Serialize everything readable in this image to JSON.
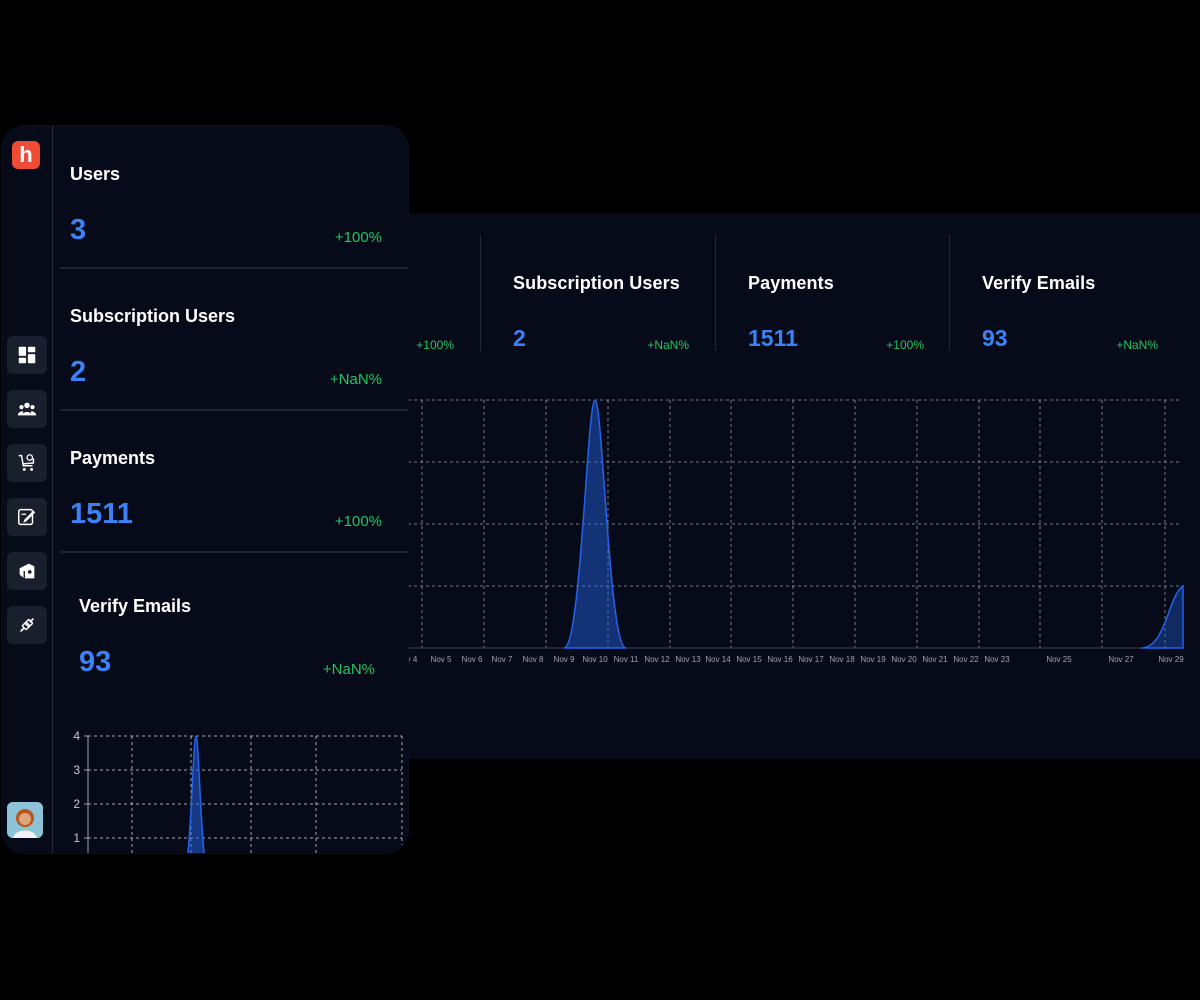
{
  "brand": {
    "logo_letter": "h",
    "accent": "#ef4b35"
  },
  "colors": {
    "value": "#3b82f6",
    "change": "#22c55e",
    "panel": "#070b19",
    "chart_line": "#2563eb"
  },
  "sidebar": {
    "items": [
      {
        "icon": "dashboard-icon"
      },
      {
        "icon": "users-icon"
      },
      {
        "icon": "cart-icon"
      },
      {
        "icon": "edit-icon"
      },
      {
        "icon": "shop-icon"
      },
      {
        "icon": "plug-icon"
      }
    ],
    "avatar": "user-avatar"
  },
  "front_stats": [
    {
      "label": "Users",
      "value": "3",
      "change": "+100%"
    },
    {
      "label": "Subscription Users",
      "value": "2",
      "change": "+NaN%"
    },
    {
      "label": "Payments",
      "value": "1511",
      "change": "+100%"
    },
    {
      "label": "Verify Emails",
      "value": "93",
      "change": "+NaN%"
    }
  ],
  "back_stats": [
    {
      "label": "",
      "value": "",
      "change": "+100%"
    },
    {
      "label": "Subscription Users",
      "value": "2",
      "change": "+NaN%"
    },
    {
      "label": "Payments",
      "value": "1511",
      "change": "+100%"
    },
    {
      "label": "Verify Emails",
      "value": "93",
      "change": "+NaN%"
    }
  ],
  "chart_data": [
    {
      "type": "area",
      "x_tick_labels": [
        "v 4",
        "Nov 5",
        "Nov 6",
        "Nov 7",
        "Nov 8",
        "Nov 9",
        "Nov 10",
        "Nov 11",
        "Nov 12",
        "Nov 13",
        "Nov 14",
        "Nov 15",
        "Nov 16",
        "Nov 17",
        "Nov 18",
        "Nov 19",
        "Nov 20",
        "Nov 21",
        "Nov 22",
        "Nov 23",
        "Nov 25",
        "Nov 27",
        "Nov 29"
      ],
      "series": [
        {
          "x": [
            "Nov 9",
            "Nov 10",
            "Nov 11",
            "Nov 27",
            "Nov 29"
          ],
          "values": [
            0,
            4,
            0,
            0,
            1
          ]
        }
      ],
      "ylim": [
        0,
        4
      ],
      "grid": true
    },
    {
      "type": "area",
      "y_tick_labels": [
        "1",
        "2",
        "3",
        "4"
      ],
      "series": [
        {
          "x": [
            "Nov 9",
            "Nov 10",
            "Nov 11"
          ],
          "values": [
            0,
            4,
            0
          ]
        }
      ],
      "ylim": [
        0,
        4
      ],
      "grid": true
    }
  ]
}
